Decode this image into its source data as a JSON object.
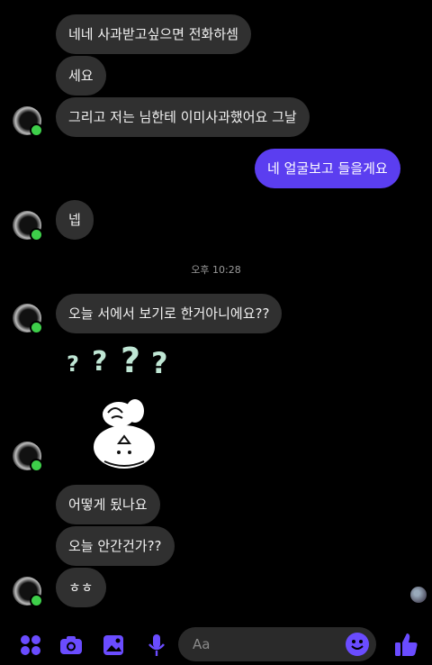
{
  "messages": [
    {
      "text": "네네 사과받고싶으면 전화하셈"
    },
    {
      "text": "세요"
    },
    {
      "text": "그리고 저는 님한테 이미사과했어요 그날"
    },
    {
      "text": "네 얼굴보고 들을게요"
    },
    {
      "text": "넵"
    },
    {
      "text": "오늘 서에서 보기로 한거아니에요??"
    },
    {
      "text": "어떻게 됬나요"
    },
    {
      "text": "오늘 안간건가??"
    },
    {
      "text": "ㅎㅎ"
    }
  ],
  "timestamp": "오후 10:28",
  "sticker": {
    "marks": [
      "?",
      "?",
      "?",
      "?"
    ]
  },
  "composer": {
    "placeholder": "Aa"
  },
  "colors": {
    "sent": "#5b3ef0",
    "received": "#303030",
    "accent": "#6a4cff",
    "online": "#3ecf4a"
  }
}
